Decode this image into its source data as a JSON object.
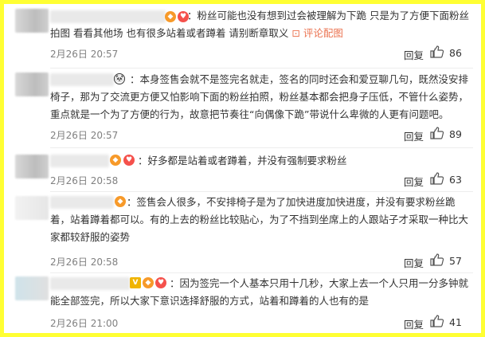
{
  "comments": [
    {
      "text": "：粉丝可能也没有想到过会被理解为下跪 只是为了方便下面粉丝拍图 看看其他场 也有很多站着或者蹲着 请别断章取义",
      "link": "评论配图",
      "time": "2月26日 20:57",
      "reply": "回复",
      "likes": "86"
    },
    {
      "text": "：本身签售会就不是签完名就走，签名的同时还会和爱豆聊几句，既然没安排椅子，那为了交流更方便又怕影响下面的粉丝拍照，粉丝基本都会把身子压低，不管什么姿势，重点就是一个为了方便的行为，故意把节奏往“向偶像下跪”带说什么卑微的人更有问题吧。",
      "time": "2月26日 20:57",
      "reply": "回复",
      "likes": "89"
    },
    {
      "text": "：好多都是站着或者蹲着，并没有强制要求粉丝",
      "time": "2月26日 20:58",
      "reply": "回复",
      "likes": "63"
    },
    {
      "text": "：签售会人很多，不安排椅子是为了加快进度加快进度，并没有要求粉丝跪着，站着蹲着都可以。有的上去的粉丝比较贴心，为了不挡到坐席上的人跟站子才采取一种比大家都较舒服的姿势",
      "time": "2月26日 20:58",
      "reply": "回复",
      "likes": "57"
    },
    {
      "text": "：因为签完一个人基本只用十几秒，大家上去一个人只用一分多钟就能全部签完，所以大家下意识选择舒服的方式，站着和蹲着的人也有的是",
      "time": "2月26日 21:00",
      "reply": "回复",
      "likes": "41"
    }
  ]
}
